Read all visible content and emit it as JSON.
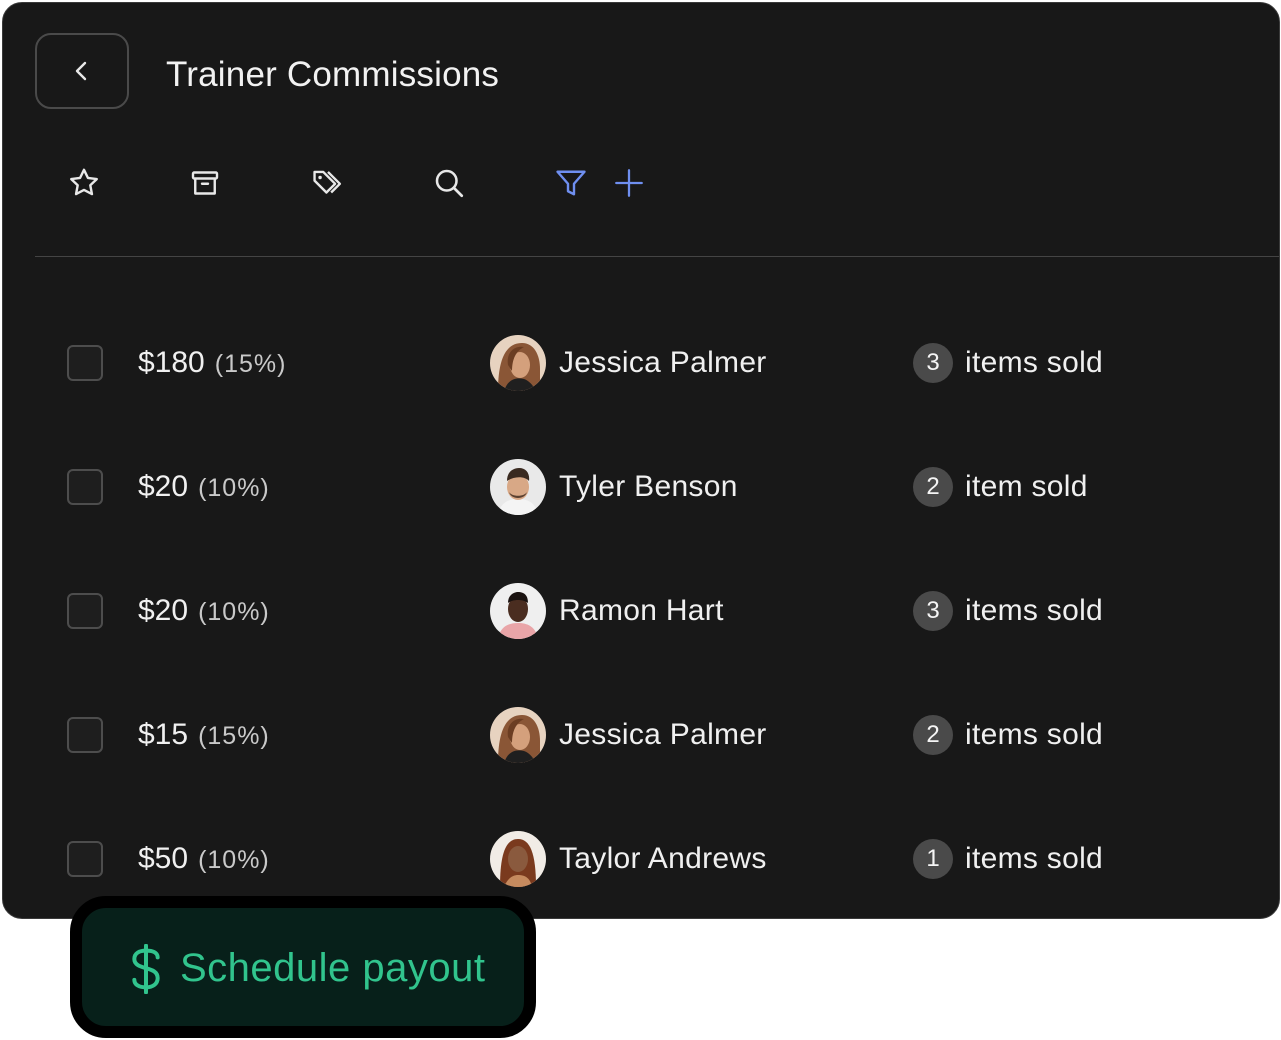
{
  "header": {
    "title": "Trainer Commissions"
  },
  "toolbar": {
    "icons": [
      "star-icon",
      "archive-icon",
      "tags-icon",
      "search-icon",
      "filter-icon",
      "plus-icon"
    ],
    "accent_color": "#6f8ff0"
  },
  "commissions": [
    {
      "amount": "$180",
      "percent": "(15%)",
      "trainer": "Jessica Palmer",
      "count": "3",
      "sold_label": "items sold"
    },
    {
      "amount": "$20",
      "percent": "(10%)",
      "trainer": "Tyler Benson",
      "count": "2",
      "sold_label": "item sold"
    },
    {
      "amount": "$20",
      "percent": "(10%)",
      "trainer": "Ramon Hart",
      "count": "3",
      "sold_label": "items sold"
    },
    {
      "amount": "$15",
      "percent": "(15%)",
      "trainer": "Jessica Palmer",
      "count": "2",
      "sold_label": "items sold"
    },
    {
      "amount": "$50",
      "percent": "(10%)",
      "trainer": "Taylor Andrews",
      "count": "1",
      "sold_label": "items sold"
    }
  ],
  "payout": {
    "label": "Schedule payout",
    "color": "#31c48d"
  }
}
